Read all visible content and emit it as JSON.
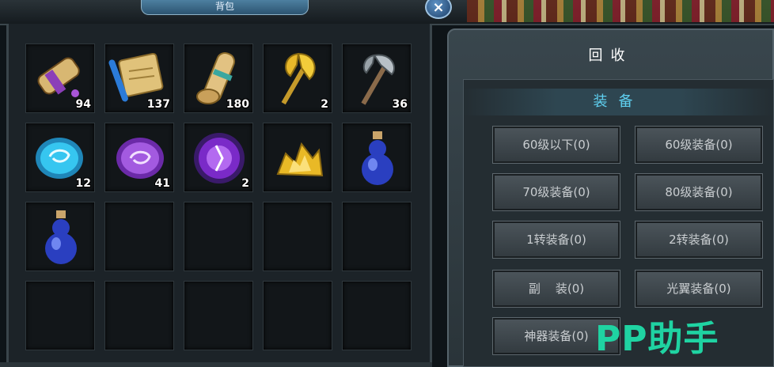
{
  "window": {
    "title": "背包",
    "close_label": "×"
  },
  "inventory": {
    "slots": [
      {
        "item": "purple-scroll-icon",
        "qty": "94"
      },
      {
        "item": "map-scroll-icon",
        "qty": "137"
      },
      {
        "item": "rolled-scroll-icon",
        "qty": "180"
      },
      {
        "item": "golden-axe-icon",
        "qty": "2"
      },
      {
        "item": "iron-axe-icon",
        "qty": "36"
      },
      {
        "item": "blue-rune-stone-icon",
        "qty": "12"
      },
      {
        "item": "purple-rune-stone-icon",
        "qty": "41"
      },
      {
        "item": "purple-orb-icon",
        "qty": "2"
      },
      {
        "item": "gold-ore-icon",
        "qty": ""
      },
      {
        "item": "blue-potion-icon",
        "qty": ""
      },
      {
        "item": "blue-potion-icon",
        "qty": ""
      },
      {
        "item": "empty",
        "qty": ""
      },
      {
        "item": "empty",
        "qty": ""
      },
      {
        "item": "empty",
        "qty": ""
      },
      {
        "item": "empty",
        "qty": ""
      },
      {
        "item": "empty",
        "qty": ""
      },
      {
        "item": "empty",
        "qty": ""
      },
      {
        "item": "empty",
        "qty": ""
      },
      {
        "item": "empty",
        "qty": ""
      },
      {
        "item": "empty",
        "qty": ""
      }
    ]
  },
  "recycle": {
    "title": "回收",
    "section": "装备",
    "buttons": [
      "60级以下(0)",
      "60级装备(0)",
      "70级装备(0)",
      "80级装备(0)",
      "1转装备(0)",
      "2转装备(0)",
      "副    装(0)",
      "光翼装备(0)",
      "神器装备(0)"
    ]
  },
  "watermark": "PP助手",
  "colors": {
    "accent": "#5fd0f0",
    "watermark": "#1fd3a2",
    "button_text": "#c9cdd0"
  }
}
